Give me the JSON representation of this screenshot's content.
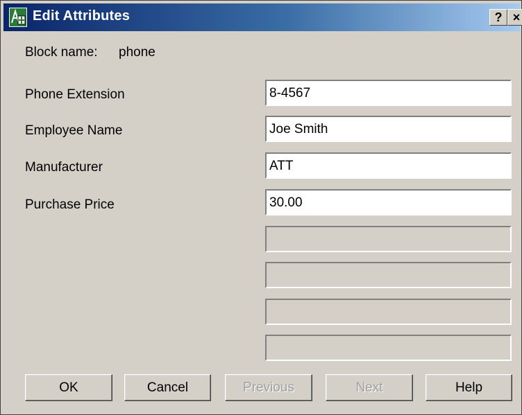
{
  "window": {
    "title": "Edit Attributes",
    "help_glyph": "?",
    "close_glyph": "×",
    "icon": "block-attribute-icon"
  },
  "block": {
    "label": "Block name:",
    "value": "phone"
  },
  "attributes": [
    {
      "label": "Phone Extension",
      "value": "8-4567"
    },
    {
      "label": "Employee Name",
      "value": "Joe Smith"
    },
    {
      "label": "Manufacturer",
      "value": "ATT"
    },
    {
      "label": "Purchase Price",
      "value": "30.00"
    }
  ],
  "buttons": {
    "ok": "OK",
    "cancel": "Cancel",
    "previous": "Previous",
    "next": "Next",
    "help": "Help"
  },
  "colors": {
    "title_start": "#0a246a",
    "title_end": "#a6caf0",
    "dialog_bg": "#d4d0c8"
  }
}
